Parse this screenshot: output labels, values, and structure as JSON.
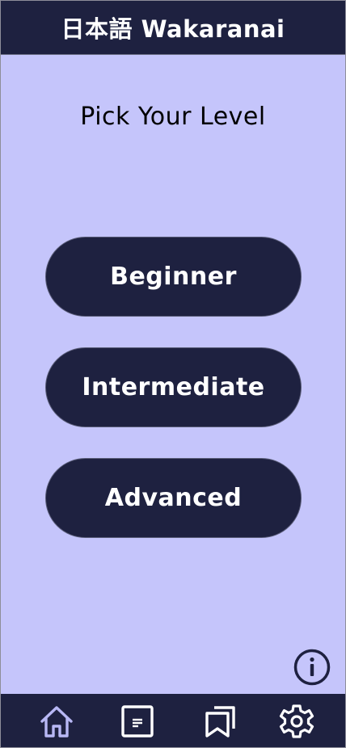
{
  "header": {
    "title": "日本語 Wakaranai"
  },
  "main": {
    "heading": "Pick Your Level",
    "levels": [
      {
        "label": "Beginner"
      },
      {
        "label": "Intermediate"
      },
      {
        "label": "Advanced"
      }
    ],
    "info_icon": "info-icon"
  },
  "bottom_nav": {
    "items": [
      {
        "icon": "home-icon",
        "active": true
      },
      {
        "icon": "notes-icon",
        "active": false
      },
      {
        "icon": "bookmarks-icon",
        "active": false
      },
      {
        "icon": "gear-icon",
        "active": false
      }
    ]
  },
  "colors": {
    "background": "#c5c5fb",
    "bars": "#1e2140",
    "active_nav": "#b8b8f5",
    "text_light": "#ffffff"
  }
}
